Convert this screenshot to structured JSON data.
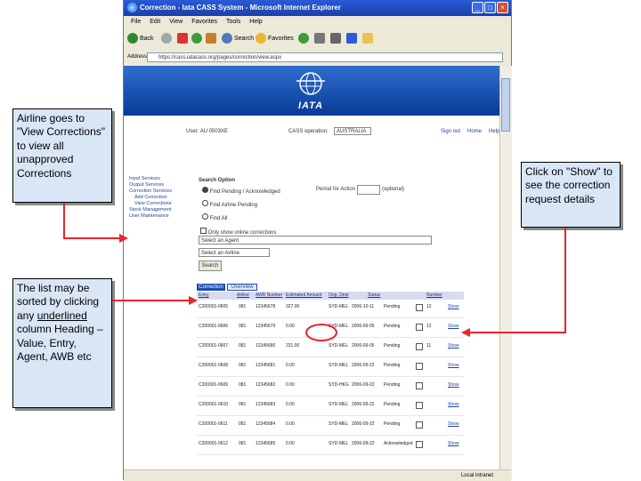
{
  "browser": {
    "title": "Correction - Iata CASS System - Microsoft Internet Explorer",
    "menu": [
      "File",
      "Edit",
      "View",
      "Favorites",
      "Tools",
      "Help"
    ],
    "toolbar": {
      "back": "Back",
      "search": "Search",
      "favorites": "Favorites"
    },
    "address_label": "Address",
    "address_value": "https://cass.iatacass.org/pages/correction/view.aspx",
    "status_left": "",
    "status_right": "Local intranet"
  },
  "banner": {
    "logo_text": "IATA"
  },
  "header": {
    "user_label": "User:",
    "user_value": "AU 0503XE",
    "cass_label": "CASS operation:",
    "cass_value": "AUSTRALIA",
    "signout": "Sign out",
    "home": "Home",
    "help": "Help"
  },
  "sidenav": {
    "items": [
      "Input Services",
      "Output Services",
      "Correction Services",
      "Add Correction",
      "View Corrections",
      "Stock Management",
      "User Maintenance"
    ]
  },
  "search": {
    "title": "Search Option",
    "options": [
      "Find Pending / Acknowledged",
      "Find Airline Pending",
      "Find All"
    ],
    "period_label": "Period for Action",
    "period_hint": "(optional)",
    "only_online": "Only show online corrections",
    "agent_select": "Select an Agent",
    "second_select": "Select an Airline",
    "search_button": "Search"
  },
  "tabs": {
    "correction": "Correction",
    "overview": "Overview"
  },
  "table": {
    "headers": [
      "Entry",
      "Airline",
      "AWB Number",
      "Estimated Amount",
      "Orig. Dest",
      "Status",
      "",
      "Number"
    ],
    "rows": [
      {
        "entry": "C200001-0605",
        "airline": "081",
        "awb": "12345678",
        "amount": "327.00",
        "orig": "SYD-MEL",
        "date": "2006-10-11",
        "status": "Pending",
        "num": "12",
        "action": "Show"
      },
      {
        "entry": "C200001-0606",
        "airline": "081",
        "awb": "12345679",
        "amount": "0.00",
        "orig": "SYD-MEL",
        "date": "2006-09-05",
        "status": "Pending",
        "num": "12",
        "action": "Show"
      },
      {
        "entry": "C200001-0607",
        "airline": "081",
        "awb": "12345680",
        "amount": "221.00",
        "orig": "SYD-MEL",
        "date": "2006-09-05",
        "status": "Pending",
        "num": "11",
        "action": "Show"
      },
      {
        "entry": "C200001-0608",
        "airline": "081",
        "awb": "12345681",
        "amount": "0.00",
        "orig": "SYD-MEL",
        "date": "2006-09-22",
        "status": "Pending",
        "num": "",
        "action": "Show"
      },
      {
        "entry": "C200001-0609",
        "airline": "081",
        "awb": "12345682",
        "amount": "0.00",
        "orig": "SYD-HKG",
        "date": "2006-09-22",
        "status": "Pending",
        "num": "",
        "action": "Show"
      },
      {
        "entry": "C200001-0610",
        "airline": "081",
        "awb": "12345683",
        "amount": "0.00",
        "orig": "SYD-MEL",
        "date": "2006-09-22",
        "status": "Pending",
        "num": "",
        "action": "Show"
      },
      {
        "entry": "C200001-0611",
        "airline": "081",
        "awb": "12345684",
        "amount": "0.00",
        "orig": "SYD-MEL",
        "date": "2006-09-22",
        "status": "Pending",
        "num": "",
        "action": "Show"
      },
      {
        "entry": "C200001-0612",
        "airline": "081",
        "awb": "12345685",
        "amount": "0.00",
        "orig": "SYD-MEL",
        "date": "2006-09-22",
        "status": "Acknowledged",
        "num": "",
        "action": "Show"
      }
    ]
  },
  "callouts": {
    "c1": "Airline goes to \"View Corrections\" to view all unapproved Corrections",
    "c2": "The list may be sorted by clicking any underlined column Heading – Value, Entry, Agent, AWB etc",
    "c2_pre": "The list may be sorted by clicking any",
    "c2_underlined": "underlined",
    "c2_post": "column Heading – Value, Entry, Agent, AWB etc",
    "c3": "Click on \"Show\" to see the correction request details"
  },
  "colors": {
    "accent": "#e8252b",
    "callout_bg": "#d9e6f6",
    "banner": "#1b4fb4"
  }
}
